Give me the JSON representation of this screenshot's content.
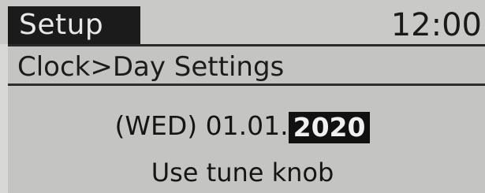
{
  "header": {
    "title": "Setup",
    "clock": "12:00"
  },
  "breadcrumb": {
    "text": "Clock>Day Settings"
  },
  "date": {
    "weekday": "(WED)",
    "day_month": "01.01.",
    "year": "2020"
  },
  "hint": {
    "text": "Use tune knob"
  },
  "colors": {
    "screen_bg": "#c4c4c2",
    "title_bg": "#1b1b1b",
    "highlight_bg": "#111111",
    "text": "#171717"
  }
}
